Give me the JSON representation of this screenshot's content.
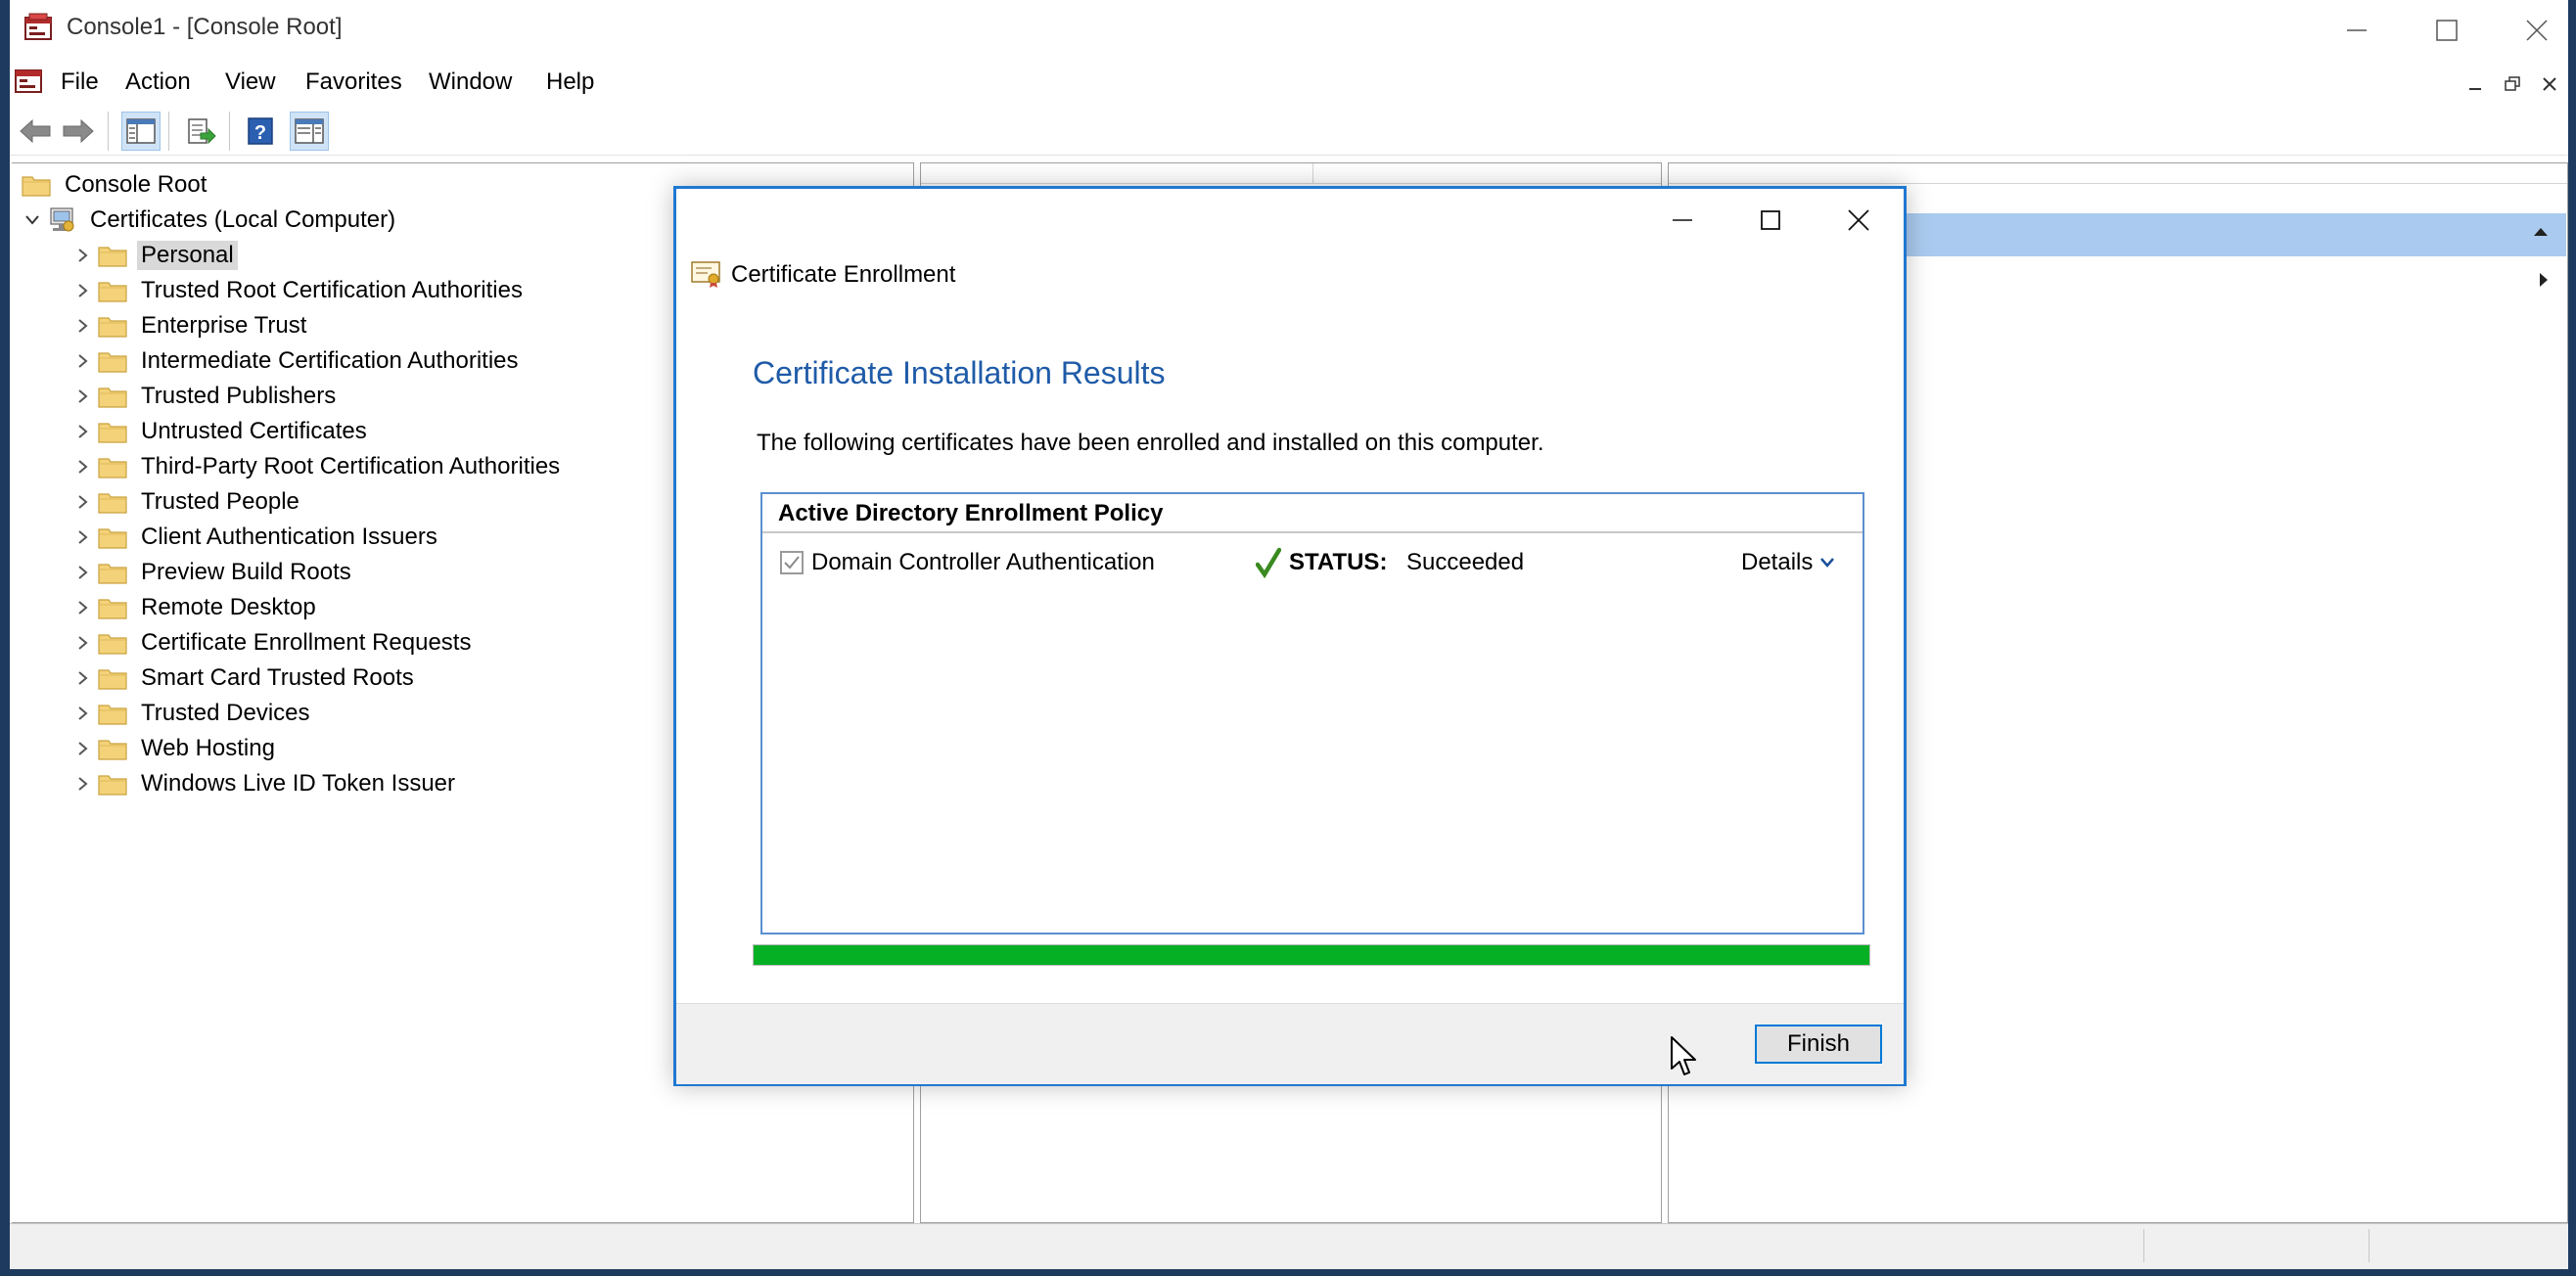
{
  "window": {
    "title": "Console1 - [Console Root]",
    "accent_color": "#1e3a5f"
  },
  "menu": [
    "File",
    "Action",
    "View",
    "Favorites",
    "Window",
    "Help"
  ],
  "toolbar": {
    "icons": [
      "back-arrow-icon",
      "forward-arrow-icon",
      "show-hide-tree-icon",
      "export-list-icon",
      "help-icon",
      "show-hide-action-pane-icon"
    ]
  },
  "tree": {
    "root": "Console Root",
    "computer": "Certificates (Local Computer)",
    "selected": "Personal",
    "stores": [
      "Personal",
      "Trusted Root Certification Authorities",
      "Enterprise Trust",
      "Intermediate Certification Authorities",
      "Trusted Publishers",
      "Untrusted Certificates",
      "Third-Party Root Certification Authorities",
      "Trusted People",
      "Client Authentication Issuers",
      "Preview Build Roots",
      "Remote Desktop",
      "Certificate Enrollment Requests",
      "Smart Card Trusted Roots",
      "Trusted Devices",
      "Web Hosting",
      "Windows Live ID Token Issuer"
    ]
  },
  "dialog": {
    "title": "Certificate Enrollment",
    "heading": "Certificate Installation Results",
    "description": "The following certificates have been enrolled and installed on this computer.",
    "policy_name": "Active Directory Enrollment Policy",
    "certificate": {
      "name": "Domain Controller Authentication",
      "checked": true,
      "status_label": "STATUS:",
      "status_value": "Succeeded",
      "details_label": "Details"
    },
    "progress_percent": 100,
    "progress_color": "#06b025",
    "finish_label": "Finish",
    "accent_color": "#1f78d1"
  }
}
